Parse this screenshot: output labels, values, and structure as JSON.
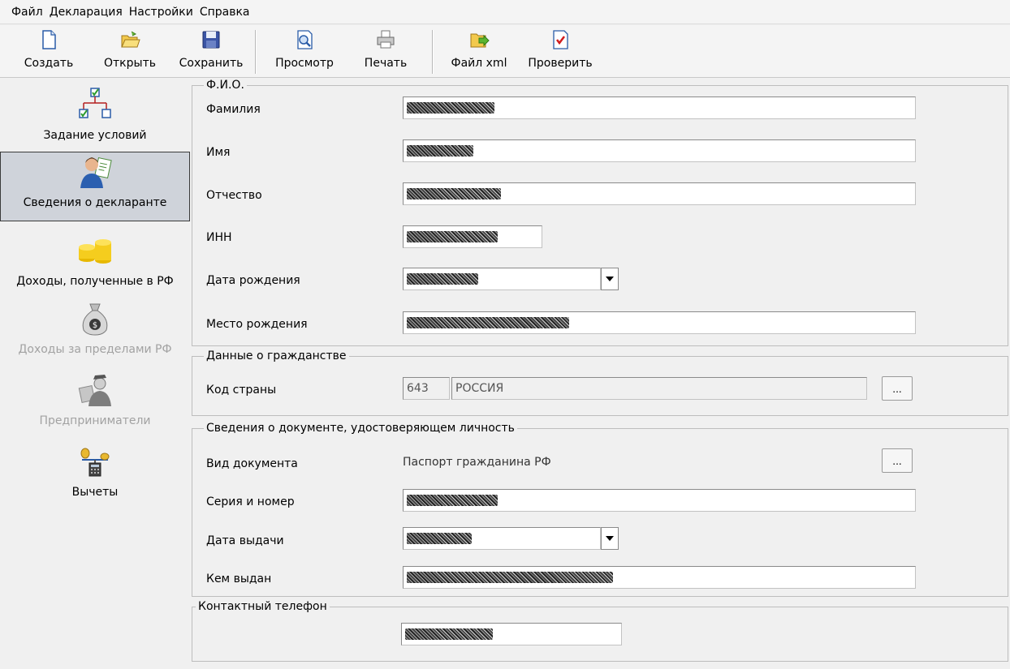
{
  "menu": [
    "Файл",
    "Декларация",
    "Настройки",
    "Справка"
  ],
  "toolbar": {
    "create": "Создать",
    "open": "Открыть",
    "save": "Сохранить",
    "preview": "Просмотр",
    "print": "Печать",
    "xml": "Файл xml",
    "check": "Проверить"
  },
  "nav": [
    {
      "label": "Задание условий",
      "icon": "conditions-icon",
      "state": "normal"
    },
    {
      "label": "Сведения о декларанте",
      "icon": "declarant-icon",
      "state": "active"
    },
    {
      "label": "Доходы, полученные в РФ",
      "icon": "coins-icon",
      "state": "normal"
    },
    {
      "label": "Доходы за пределами РФ",
      "icon": "money-bag-icon",
      "state": "disabled"
    },
    {
      "label": "Предприниматели",
      "icon": "entrepreneur-icon",
      "state": "disabled"
    },
    {
      "label": "Вычеты",
      "icon": "deductions-icon",
      "state": "normal"
    }
  ],
  "fio": {
    "title": "Ф.И.О.",
    "surname_label": "Фамилия",
    "name_label": "Имя",
    "patronymic_label": "Отчество",
    "inn_label": "ИНН",
    "birthdate_label": "Дата рождения",
    "birthplace_label": "Место рождения"
  },
  "citizenship": {
    "title": "Данные о гражданстве",
    "country_code_label": "Код страны",
    "country_code": "643",
    "country_name": "РОССИЯ",
    "browse_label": "..."
  },
  "document": {
    "title": "Сведения о документе, удостоверяющем личность",
    "type_label": "Вид документа",
    "type_value": "Паспорт гражданина РФ",
    "browse_label": "...",
    "series_label": "Серия и номер",
    "issue_date_label": "Дата выдачи",
    "issued_by_label": "Кем выдан"
  },
  "contact": {
    "title": "Контактный телефон"
  },
  "colors": {
    "background": "#f0f0f0",
    "active_nav": "#cfd3da",
    "disabled_text": "#a2a2a2"
  }
}
